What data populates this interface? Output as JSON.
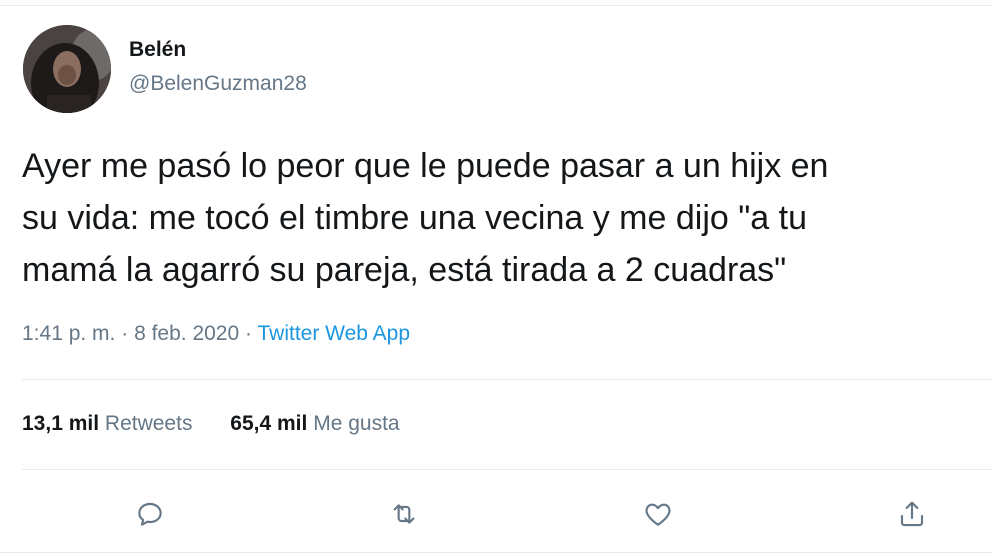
{
  "user": {
    "display_name": "Belén",
    "handle": "@BelenGuzman28"
  },
  "tweet": {
    "text_lines": [
      "Ayer me pasó lo peor que le puede pasar a un hijx en",
      "su vida: me tocó el timbre una vecina y me dijo \"a tu",
      "mamá la agarró su pareja, está tirada a 2 cuadras\""
    ],
    "time": "1:41 p. m.",
    "date": "8 feb. 2020",
    "separator": "·",
    "source": "Twitter Web App"
  },
  "stats": {
    "retweets_count": "13,1 mil",
    "retweets_label": "Retweets",
    "likes_count": "65,4 mil",
    "likes_label": "Me gusta"
  },
  "actions": {
    "reply_icon": "reply-icon",
    "retweet_icon": "retweet-icon",
    "like_icon": "heart-icon",
    "share_icon": "share-icon"
  },
  "colors": {
    "text": "#14171a",
    "secondary": "#657786",
    "link": "#1b95e0",
    "border": "#e6ecf0"
  }
}
